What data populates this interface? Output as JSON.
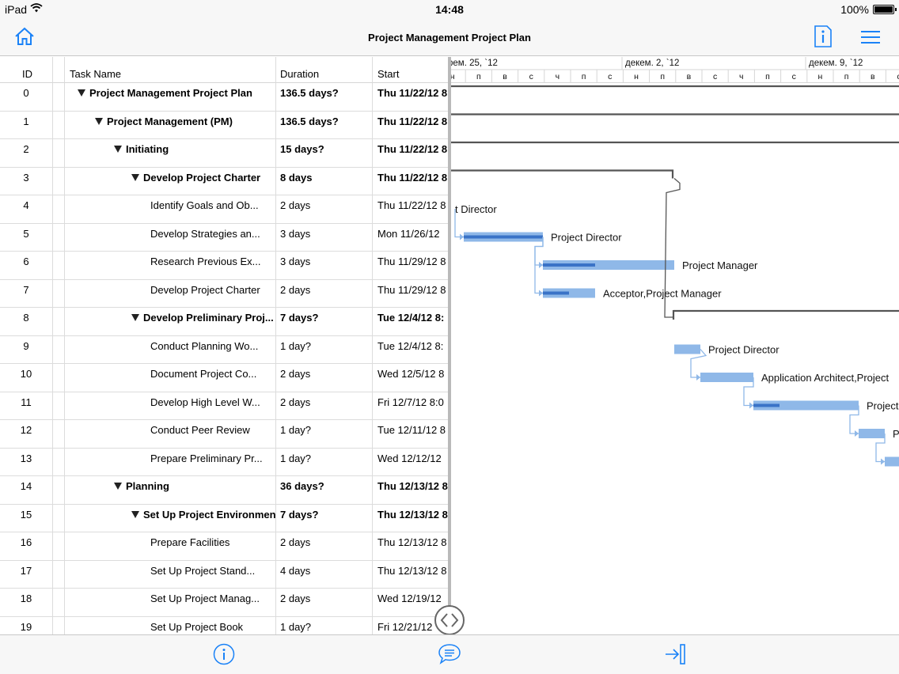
{
  "status": {
    "device": "iPad",
    "time": "14:48",
    "battery": "100%"
  },
  "nav": {
    "title": "Project Management Project Plan"
  },
  "columns": {
    "id": "ID",
    "name": "Task Name",
    "duration": "Duration",
    "start": "Start"
  },
  "rows": [
    {
      "id": "0",
      "name": "Project Management Project Plan",
      "duration": "136.5 days?",
      "start": "Thu 11/22/12 8",
      "summary": true,
      "level": 0
    },
    {
      "id": "1",
      "name": "Project Management (PM)",
      "duration": "136.5 days?",
      "start": "Thu 11/22/12 8",
      "summary": true,
      "level": 1
    },
    {
      "id": "2",
      "name": "Initiating",
      "duration": "15 days?",
      "start": "Thu 11/22/12 8",
      "summary": true,
      "level": 2
    },
    {
      "id": "3",
      "name": "Develop Project Charter",
      "duration": "8 days",
      "start": "Thu 11/22/12 8",
      "summary": true,
      "level": 3
    },
    {
      "id": "4",
      "name": "Identify Goals and Ob...",
      "duration": "2 days",
      "start": "Thu 11/22/12 8",
      "summary": false,
      "level": 4
    },
    {
      "id": "5",
      "name": "Develop Strategies an...",
      "duration": "3 days",
      "start": "Mon 11/26/12",
      "summary": false,
      "level": 4
    },
    {
      "id": "6",
      "name": "Research Previous Ex...",
      "duration": "3 days",
      "start": "Thu 11/29/12 8",
      "summary": false,
      "level": 4
    },
    {
      "id": "7",
      "name": "Develop Project Charter",
      "duration": "2 days",
      "start": "Thu 11/29/12 8",
      "summary": false,
      "level": 4
    },
    {
      "id": "8",
      "name": "Develop Preliminary Proj...",
      "duration": "7 days?",
      "start": "Tue 12/4/12 8:",
      "summary": true,
      "level": 3
    },
    {
      "id": "9",
      "name": "Conduct Planning Wo...",
      "duration": "1 day?",
      "start": "Tue 12/4/12 8:",
      "summary": false,
      "level": 4
    },
    {
      "id": "10",
      "name": "Document Project Co...",
      "duration": "2 days",
      "start": "Wed 12/5/12 8",
      "summary": false,
      "level": 4
    },
    {
      "id": "11",
      "name": "Develop High Level W...",
      "duration": "2 days",
      "start": "Fri 12/7/12 8:0",
      "summary": false,
      "level": 4
    },
    {
      "id": "12",
      "name": "Conduct Peer Review",
      "duration": "1 day?",
      "start": "Tue 12/11/12 8",
      "summary": false,
      "level": 4
    },
    {
      "id": "13",
      "name": "Prepare Preliminary Pr...",
      "duration": "1 day?",
      "start": "Wed 12/12/12",
      "summary": false,
      "level": 4
    },
    {
      "id": "14",
      "name": "Planning",
      "duration": "36 days?",
      "start": "Thu 12/13/12 8",
      "summary": true,
      "level": 2
    },
    {
      "id": "15",
      "name": "Set Up Project Environment",
      "duration": "7 days?",
      "start": "Thu 12/13/12 8",
      "summary": true,
      "level": 3
    },
    {
      "id": "16",
      "name": "Prepare Facilities",
      "duration": "2 days",
      "start": "Thu 12/13/12 8",
      "summary": false,
      "level": 4
    },
    {
      "id": "17",
      "name": "Set Up Project Stand...",
      "duration": "4 days",
      "start": "Thu 12/13/12 8",
      "summary": false,
      "level": 4
    },
    {
      "id": "18",
      "name": "Set Up Project Manag...",
      "duration": "2 days",
      "start": "Wed 12/19/12",
      "summary": false,
      "level": 4
    },
    {
      "id": "19",
      "name": "Set Up Project Book",
      "duration": "1 day?",
      "start": "Fri 12/21/12",
      "summary": false,
      "level": 4
    }
  ],
  "gantt": {
    "weeks": [
      "рем. 25, `12",
      "декем. 2, `12",
      "декем. 9, `12"
    ],
    "days": [
      "н",
      "п",
      "в",
      "с",
      "ч",
      "п",
      "с",
      "н",
      "п",
      "в",
      "с",
      "ч",
      "п",
      "с",
      "н",
      "п",
      "в",
      "с"
    ],
    "labels": [
      {
        "row": 4,
        "text": "t Director"
      },
      {
        "row": 5,
        "text": "Project Director"
      },
      {
        "row": 6,
        "text": "Project Manager"
      },
      {
        "row": 7,
        "text": "Acceptor,Project Manager"
      },
      {
        "row": 9,
        "text": "Project Director"
      },
      {
        "row": 10,
        "text": "Application Architect,Project"
      },
      {
        "row": 11,
        "text": "Project"
      },
      {
        "row": 12,
        "text": "P"
      }
    ],
    "bar_color": "#8fb8e8",
    "progress_color": "#3a73c7"
  },
  "icons": {
    "home": "home-icon",
    "info": "info-icon",
    "menu": "menu-icon",
    "details": "details-icon",
    "comment": "comment-icon",
    "collapse": "collapse-pane-icon",
    "resize": "resize-handle-icon"
  }
}
